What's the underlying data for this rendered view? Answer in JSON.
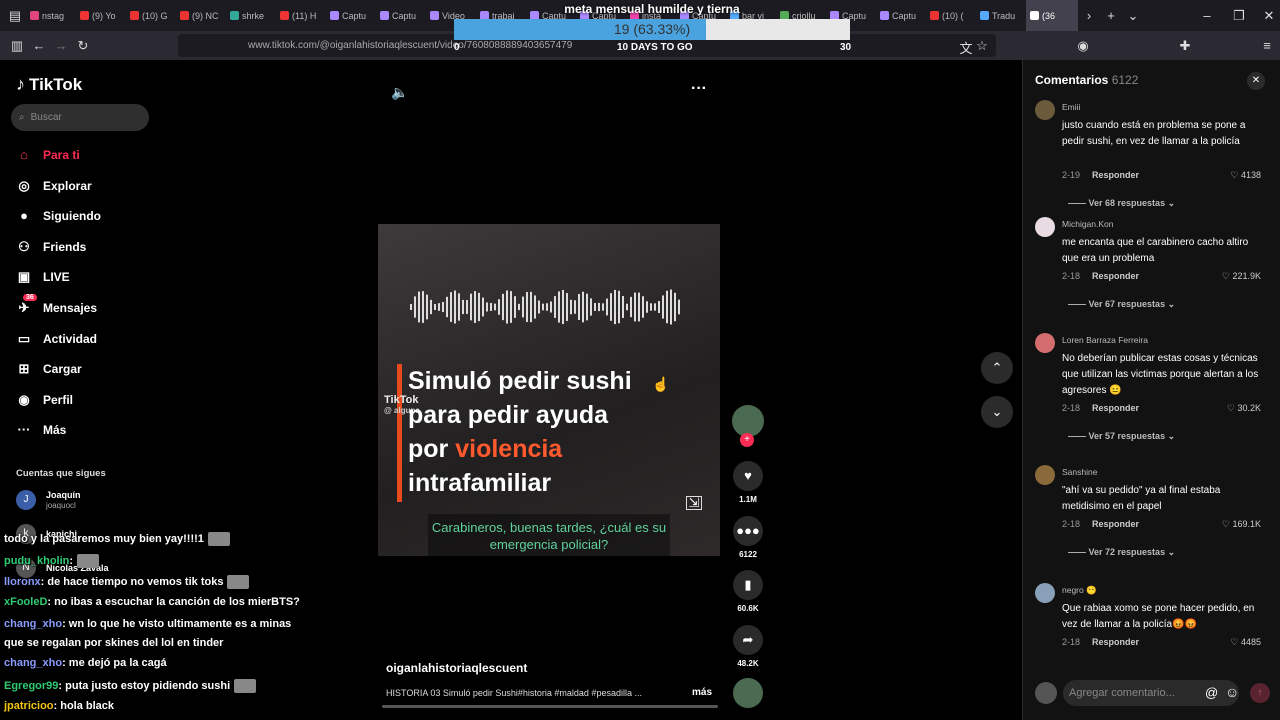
{
  "browser": {
    "tabs": [
      "nstag",
      "(9) Yo",
      "(10) G",
      "(9) NC",
      "shrke",
      "(11) H",
      "Captu",
      "Captu",
      "Video",
      "trabaj",
      "Captu",
      "Captu",
      "insta",
      "Captu",
      "bar vi",
      "criollu",
      "Captu",
      "Captu",
      "(10) (",
      "Tradu",
      "(36"
    ],
    "url": "www.tiktok.com/@oiganlahistoriaqlescuent/video/7608088889403657479"
  },
  "goal": {
    "title": "meta mensual humilde y tierna",
    "value_text": "19 (63.33%)",
    "progress": 0.6333,
    "min": "0",
    "days_left": "10 DAYS TO GO",
    "max": "30"
  },
  "sidebar": {
    "logo": "TikTok",
    "search_placeholder": "Buscar",
    "items": [
      {
        "label": "Para ti",
        "icon": "home-icon"
      },
      {
        "label": "Explorar",
        "icon": "compass-icon"
      },
      {
        "label": "Siguiendo",
        "icon": "following-icon"
      },
      {
        "label": "Friends",
        "icon": "friends-icon"
      },
      {
        "label": "LIVE",
        "icon": "live-icon"
      },
      {
        "label": "Mensajes",
        "icon": "messages-icon",
        "badge": "36"
      },
      {
        "label": "Actividad",
        "icon": "activity-icon"
      },
      {
        "label": "Cargar",
        "icon": "upload-icon"
      },
      {
        "label": "Perfil",
        "icon": "profile-icon"
      },
      {
        "label": "Más",
        "icon": "more-icon"
      }
    ],
    "following_title": "Cuentas que sigues",
    "following": [
      {
        "name": "Joaquín",
        "handle": "joaquocl"
      },
      {
        "name": "kapichi",
        "handle": ""
      },
      {
        "name": "Nicolas Zavala",
        "handle": ""
      }
    ]
  },
  "chat": [
    {
      "user": "",
      "msg": "todo y la pasaremos muy bien yay!!!!1",
      "color": "#ffffff"
    },
    {
      "user": "pudu_kholin",
      "msg": ":",
      "color": "#2ecc71"
    },
    {
      "user": "lloronx",
      "msg": ": de hace tiempo no vemos tik toks",
      "color": "#8a9cff"
    },
    {
      "user": "xFooleD",
      "msg": ": no ibas a escuchar la canción de los mierBTS?",
      "color": "#2ecc71"
    },
    {
      "user": "chang_xho",
      "msg": ": wn lo que he visto ultimamente es a minas",
      "color": "#8a9cff"
    },
    {
      "user": "",
      "msg": "que se regalan por skines del lol en tinder",
      "color": "#ffffff"
    },
    {
      "user": "chang_xho",
      "msg": ": me dejó pa la cagá",
      "color": "#8a9cff"
    },
    {
      "user": "Egregor99",
      "msg": ": puta justo estoy pidiendo sushi",
      "color": "#2ecc71"
    },
    {
      "user": "jpatricioo",
      "msg": ": hola black",
      "color": "#f1c40f"
    }
  ],
  "video": {
    "title_lines": [
      "Simuló pedir sushi",
      "para pedir ayuda"
    ],
    "line3_a": "por ",
    "line3_b": "violencia",
    "line4": "intrafamiliar",
    "watermark": "TikTok",
    "watermark_handle": "@ alguna",
    "subtitle": "Carabineros, buenas tardes, ¿cuál es su emergencia policial?",
    "author": "oiganlahistoriaqlescuent",
    "caption": "HISTORIA 03 Simuló pedir Sushi#historia #maldad #pesadilla ...",
    "more": "más"
  },
  "actions": {
    "likes": "1.1M",
    "comments": "6122",
    "saves": "60.6K",
    "shares": "48.2K"
  },
  "comments": {
    "title": "Comentarios",
    "count": "6122",
    "input_placeholder": "Agregar comentario...",
    "items": [
      {
        "user": "Emiii",
        "text": "justo cuando está en problema se pone a pedir sushi, en vez de llamar a la policía",
        "date": "2-19",
        "reply": "Responder",
        "likes": "4138",
        "replies": "Ver 68 respuestas"
      },
      {
        "user": "Michigan.Kon",
        "text": "me encanta que el carabinero cacho altiro que era un problema",
        "date": "2-18",
        "reply": "Responder",
        "likes": "221.9K",
        "replies": "Ver 67 respuestas"
      },
      {
        "user": "Loren Barraza Ferreira",
        "text": "No deberían publicar estas cosas y técnicas que utilizan las victimas porque alertan a los agresores 😐",
        "date": "2-18",
        "reply": "Responder",
        "likes": "30.2K",
        "replies": "Ver 57 respuestas"
      },
      {
        "user": "Sanshine",
        "text": "\"ahí va su pedido\" ya al final estaba metidisimo en el papel",
        "date": "2-18",
        "reply": "Responder",
        "likes": "169.1K",
        "replies": "Ver 72 respuestas"
      },
      {
        "user": "negro 😶",
        "text": "Que rabiaa xomo se pone hacer pedido, en vez de llamar a la policía😡😡",
        "date": "2-18",
        "reply": "Responder",
        "likes": "4485",
        "replies": ""
      }
    ]
  }
}
